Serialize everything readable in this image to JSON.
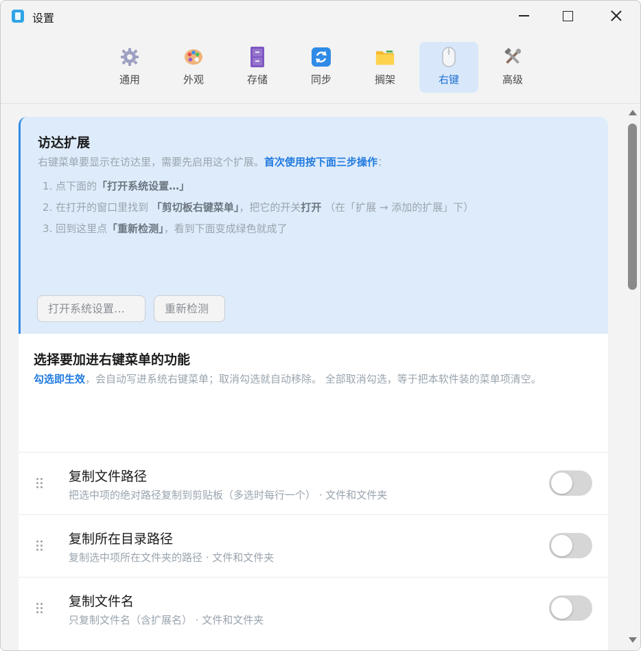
{
  "window": {
    "title": "设置",
    "icons": {
      "app": "clipboard-app-icon",
      "minimize": "minimize-icon",
      "maximize": "maximize-icon",
      "close": "close-icon"
    }
  },
  "tabs": [
    {
      "label": "通用",
      "icon": "gear-icon",
      "glyph": "⚙",
      "color": "#8c8fb0"
    },
    {
      "label": "外观",
      "icon": "palette-icon",
      "glyph": "🎨",
      "color": "#e08a3c"
    },
    {
      "label": "存储",
      "icon": "cabinet-icon",
      "glyph": "🗄",
      "color": "#7b55b8"
    },
    {
      "label": "同步",
      "icon": "sync-icon",
      "glyph": "🔄",
      "color": "#2f8be6"
    },
    {
      "label": "搁架",
      "icon": "folder-icon",
      "glyph": "📁",
      "color": "#f2b630"
    },
    {
      "label": "右键",
      "icon": "mouse-icon",
      "glyph": "🖱",
      "color": "#b9bcc2",
      "active": true
    },
    {
      "label": "高级",
      "icon": "tools-icon",
      "glyph": "🛠",
      "color": "#7a7f87"
    }
  ],
  "finder_extension": {
    "title": "访达扩展",
    "desc_prefix": "右键菜单要显示在访达里，需要先启用这个扩展。",
    "desc_emphasis": "首次使用按下面三步操作",
    "desc_suffix": "：",
    "steps": [
      {
        "prefix": "1. 点下面的",
        "bold": "「打开系统设置…」",
        "suffix": ""
      },
      {
        "prefix": "2. 在打开的窗口里找到 ",
        "bold": "「剪切板右键菜单」",
        "mid": "，把它的开关",
        "bold2": "打开",
        "suffix": " （在「扩展 → 添加的扩展」下）"
      },
      {
        "prefix": "3. 回到这里点",
        "bold": "「重新检测」",
        "suffix": "，看到下面变成绿色就成了"
      }
    ],
    "buttons": {
      "open_settings": "打开系统设置…",
      "recheck": "重新检测"
    }
  },
  "features": {
    "title": "选择要加进右键菜单的功能",
    "desc_emphasis": "勾选即生效",
    "desc_rest": "，会自动写进系统右键菜单；取消勾选就自动移除。 全部取消勾选，等于把本软件装的菜单项清空。",
    "items": [
      {
        "title": "复制文件路径",
        "desc": "把选中项的绝对路径复制到剪贴板（多选时每行一个） · 文件和文件夹",
        "enabled": false
      },
      {
        "title": "复制所在目录路径",
        "desc": "复制选中项所在文件夹的路径 · 文件和文件夹",
        "enabled": false
      },
      {
        "title": "复制文件名",
        "desc": "只复制文件名（含扩展名） · 文件和文件夹",
        "enabled": false
      }
    ]
  }
}
